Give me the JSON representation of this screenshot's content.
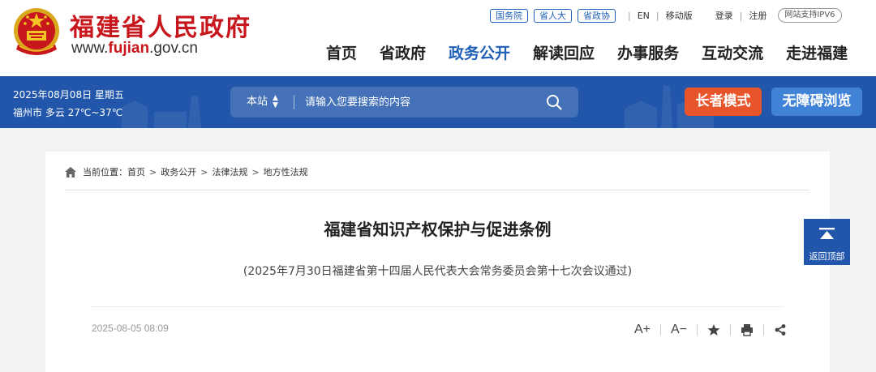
{
  "header": {
    "site_title": "福建省人民政府",
    "site_url_prefix": "www.",
    "site_url_highlight": "fujian",
    "site_url_suffix": ".gov.cn",
    "top_links": [
      "国务院",
      "省人大",
      "省政协"
    ],
    "lang": "EN",
    "mobile": "移动版",
    "login": "登录",
    "register": "注册",
    "ipv6_badge": "网站支持IPV6"
  },
  "nav": {
    "items": [
      "首页",
      "省政府",
      "政务公开",
      "解读回应",
      "办事服务",
      "互动交流",
      "走进福建"
    ],
    "active": "政务公开"
  },
  "band": {
    "date": "2025年08月08日 星期五",
    "weather": "福州市 多云 27℃~37℃",
    "search_scope": "本站",
    "search_placeholder": "请输入您要搜索的内容",
    "elder_mode": "长者模式",
    "accessible": "无障碍浏览"
  },
  "breadcrumb": {
    "label": "当前位置：",
    "items": [
      "首页",
      "政务公开",
      "法律法规",
      "地方性法规"
    ]
  },
  "article": {
    "title": "福建省知识产权保护与促进条例",
    "subtitle": "(2025年7月30日福建省第十四届人民代表大会常务委员会第十七次会议通过)",
    "date": "2025-08-05 08:09",
    "font_increase": "A+",
    "font_decrease": "A−"
  },
  "backtop": {
    "label": "返回顶部"
  },
  "colors": {
    "brand_red": "#c8161d",
    "brand_blue": "#2156aa",
    "elder_orange": "#e8552a",
    "accessible_blue": "#3f82d6"
  },
  "icons": [
    "national-emblem-icon",
    "search-icon",
    "sort-arrows-icon",
    "home-icon",
    "star-icon",
    "print-icon",
    "share-icon",
    "back-to-top-icon"
  ]
}
